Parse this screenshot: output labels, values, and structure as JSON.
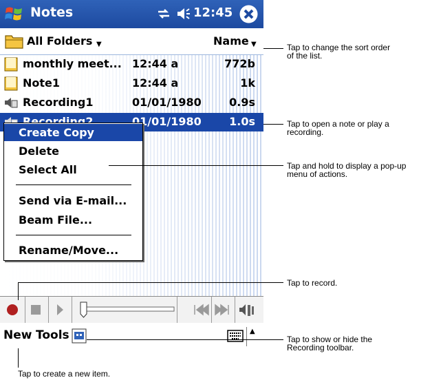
{
  "title_bar": {
    "app_name": "Notes",
    "time": "12:45"
  },
  "folder_bar": {
    "folder": "All Folders",
    "sort": "Name"
  },
  "notes_list": [
    {
      "name": "monthly meet...",
      "time": "12:44 a",
      "size": "772b",
      "type": "note"
    },
    {
      "name": "Note1",
      "time": "12:44 a",
      "size": "1k",
      "type": "note"
    },
    {
      "name": "Recording1",
      "time": "01/01/1980",
      "size": "0.9s",
      "type": "recording"
    },
    {
      "name": "Recording2",
      "time": "01/01/1980",
      "size": "1.0s",
      "type": "recording",
      "selected": true
    }
  ],
  "popup_menu": {
    "items": [
      "Create Copy",
      "Delete",
      "Select All",
      "Send via E-mail...",
      "Beam File...",
      "Rename/Move..."
    ]
  },
  "menu_bar": {
    "new": "New",
    "tools": "Tools"
  },
  "callouts": {
    "sort": "Tap to change the sort order\nof the list.",
    "open": "Tap to open a note or play a\nrecording.",
    "hold": "Tap and hold to display a pop-up\nmenu of actions.",
    "record": "Tap to record.",
    "toolbar": "Tap to show or hide the\nRecording toolbar.",
    "create": "Tap to create a new item."
  },
  "colors": {
    "title_bar": "#1d4aa0",
    "selection": "#1a47a8",
    "record_red": "#b02020"
  }
}
